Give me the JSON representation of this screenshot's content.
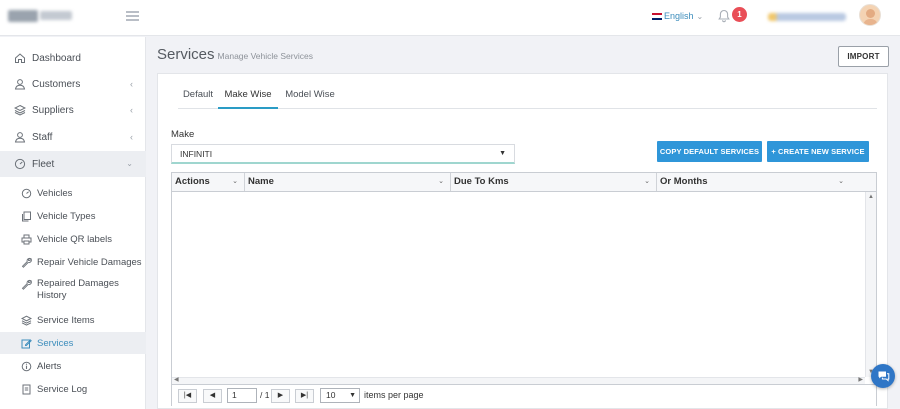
{
  "header": {
    "language": "English",
    "notifications": "1",
    "language_icon": "uk-flag-icon"
  },
  "sidebar": {
    "items": [
      {
        "label": "Dashboard",
        "icon": "home-icon"
      },
      {
        "label": "Customers",
        "icon": "user-icon"
      },
      {
        "label": "Suppliers",
        "icon": "layers-icon"
      },
      {
        "label": "Staff",
        "icon": "user-icon"
      },
      {
        "label": "Fleet",
        "icon": "gauge-icon"
      }
    ],
    "fleet_items": [
      {
        "label": "Vehicles",
        "icon": "gauge-icon"
      },
      {
        "label": "Vehicle Types",
        "icon": "copy-icon"
      },
      {
        "label": "Vehicle QR labels",
        "icon": "print-icon"
      },
      {
        "label": "Repair Vehicle Damages",
        "icon": "wrench-icon"
      },
      {
        "label": "Repaired Damages History",
        "icon": "wrench-icon"
      },
      {
        "label": "Service Items",
        "icon": "layers-icon"
      },
      {
        "label": "Services",
        "icon": "edit-icon"
      },
      {
        "label": "Alerts",
        "icon": "info-icon"
      },
      {
        "label": "Service Log",
        "icon": "copy-icon"
      }
    ]
  },
  "page": {
    "title": "Services",
    "subtitle": "Manage Vehicle Services",
    "import_label": "IMPORT"
  },
  "tabs": [
    {
      "label": "Default"
    },
    {
      "label": "Make Wise"
    },
    {
      "label": "Model Wise"
    }
  ],
  "form": {
    "make_label": "Make",
    "make_value": "INFINITI"
  },
  "buttons": {
    "copy_default": "COPY DEFAULT SERVICES",
    "create_new": "+ CREATE NEW SERVICE"
  },
  "grid": {
    "columns": [
      "Actions",
      "Name",
      "Due To Kms",
      "Or Months"
    ]
  },
  "pager": {
    "page": "1",
    "of": "/ 1",
    "page_size": "10",
    "items_per_page": "items per page"
  },
  "colors": {
    "accent": "#2f96d9",
    "tab_underline": "#2a9cc5",
    "badge": "#e94e57",
    "active_link": "#3c8dbc"
  }
}
